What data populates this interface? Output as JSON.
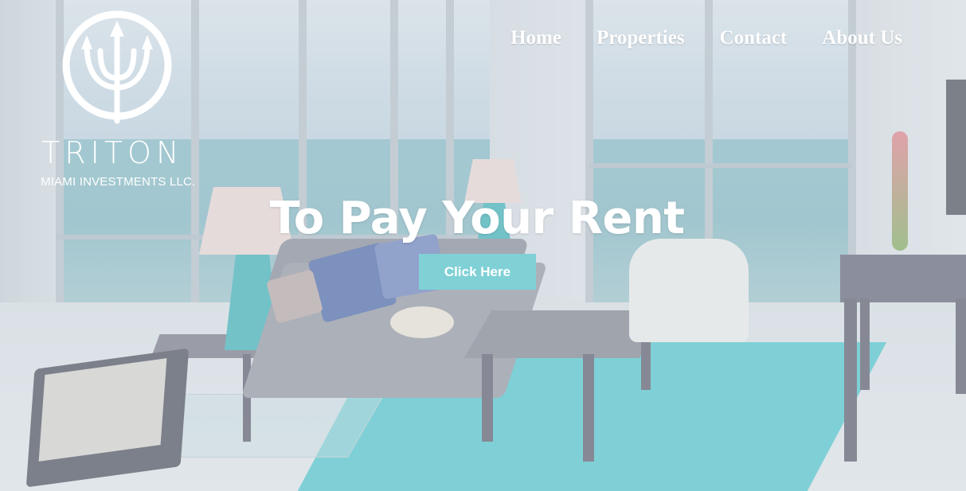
{
  "logo": {
    "icon": "trident-icon",
    "title": "TRITON",
    "subtitle": "MIAMI INVESTMENTS LLC."
  },
  "nav": {
    "items": [
      {
        "label": "Home"
      },
      {
        "label": "Properties"
      },
      {
        "label": "Contact"
      },
      {
        "label": "About Us"
      }
    ]
  },
  "hero": {
    "title": "To Pay Your Rent",
    "button_label": "Click Here"
  },
  "colors": {
    "accent": "#7fd1d6",
    "text": "#ffffff"
  }
}
